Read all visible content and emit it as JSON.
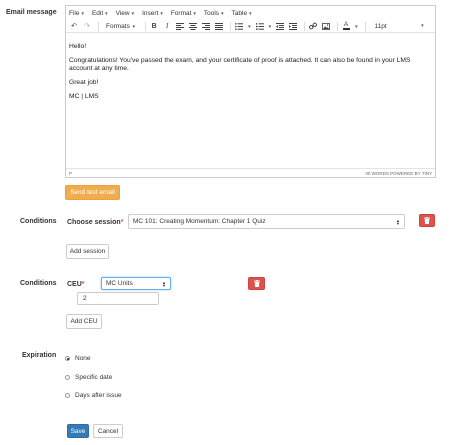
{
  "labels": {
    "email_message": "Email message",
    "conditions_session": "Conditions",
    "conditions_ceu": "Conditions",
    "expiration": "Expiration"
  },
  "editor": {
    "menus": [
      "File",
      "Edit",
      "View",
      "Insert",
      "Format",
      "Tools",
      "Table"
    ],
    "formats_label": "Formats",
    "font_size": "11pt",
    "content": {
      "line1": "Hello!",
      "line2": "Congratulations! You've passed the exam, and your certificate of proof is attached. It can also be found in your LMS account at any time.",
      "line3": "Great job!",
      "line4": "MC | LMS"
    },
    "status_path": "P",
    "word_count": "30 WORDS POWERED BY TINY"
  },
  "buttons": {
    "send_test_email": "Send test email",
    "add_session": "Add session",
    "add_ceu": "Add CEU",
    "save": "Save",
    "cancel": "Cancel"
  },
  "session": {
    "label": "Choose session",
    "required_mark": "*",
    "selected": "MC 101: Creating Momentum: Chapter 1 Quiz"
  },
  "ceu": {
    "label": "CEU",
    "required_mark": "*",
    "selected": "MC Units",
    "value": "2"
  },
  "expiration": {
    "options": [
      "None",
      "Specific date",
      "Days after issue"
    ],
    "selected_index": 0
  },
  "colors": {
    "orange": "#f0ad4e",
    "primary": "#337ab7",
    "danger": "#d9534f"
  }
}
